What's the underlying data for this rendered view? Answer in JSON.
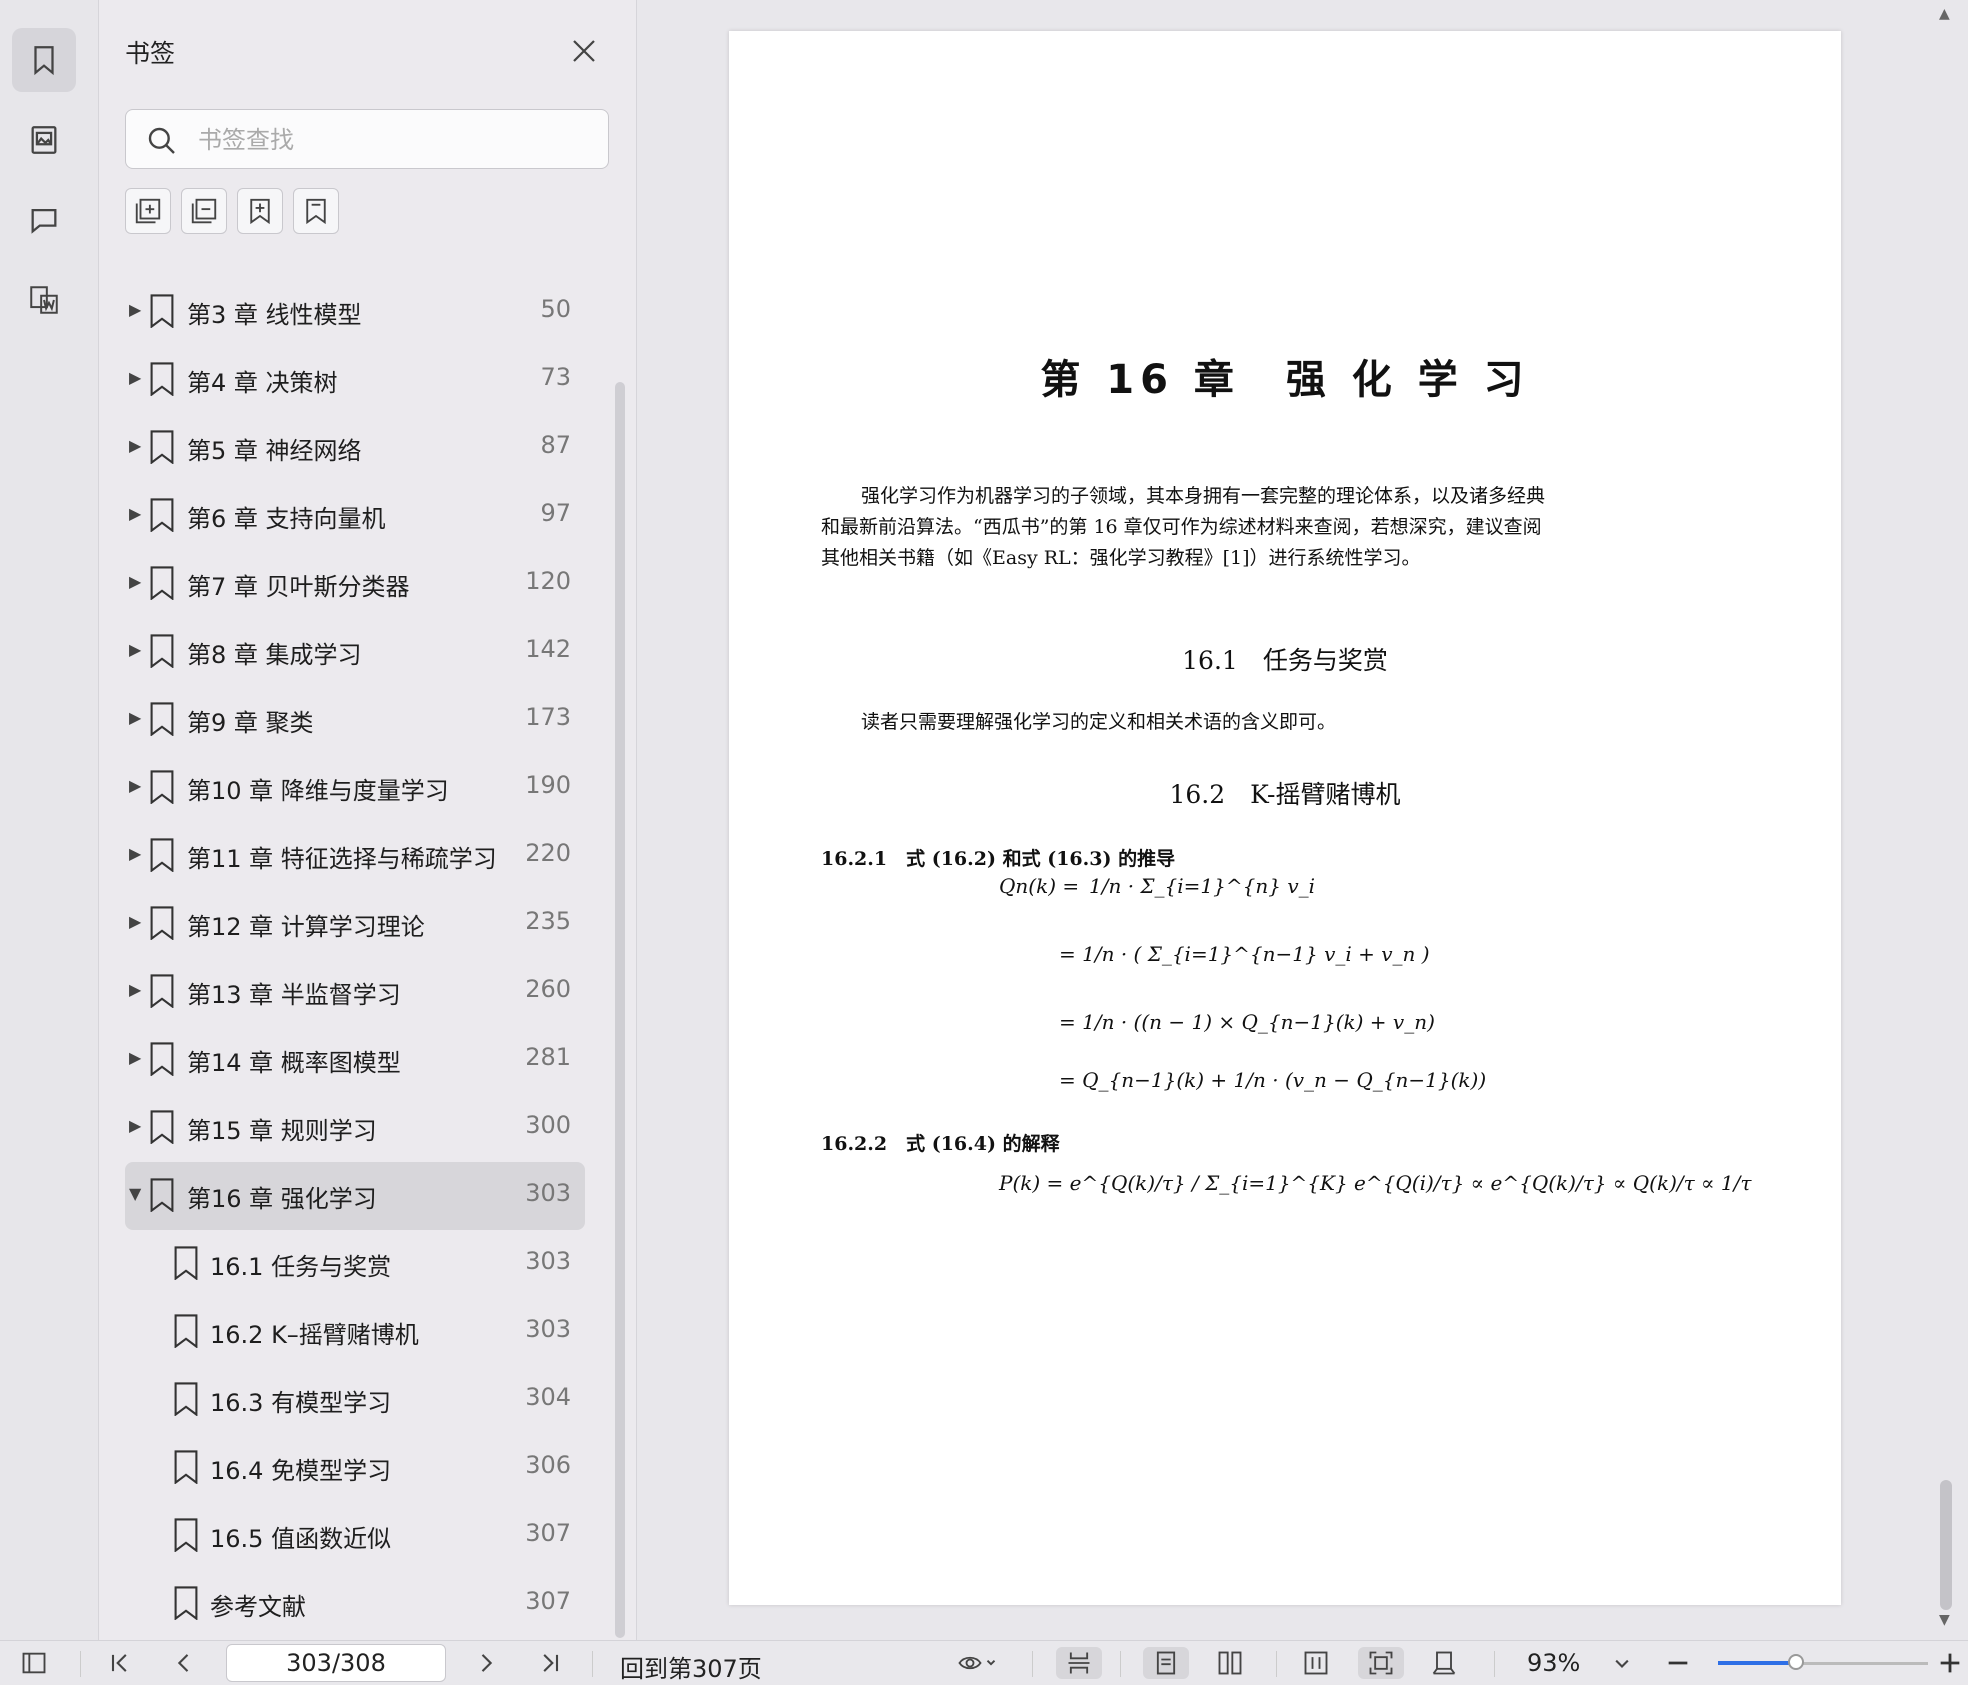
{
  "sidebar": {
    "title": "书签",
    "search_placeholder": "书签查找",
    "items": [
      {
        "label": "第3 章 线性模型",
        "page": "50",
        "expanded": false,
        "level": 0
      },
      {
        "label": "第4 章 决策树",
        "page": "73",
        "expanded": false,
        "level": 0
      },
      {
        "label": "第5 章 神经网络",
        "page": "87",
        "expanded": false,
        "level": 0
      },
      {
        "label": "第6 章 支持向量机",
        "page": "97",
        "expanded": false,
        "level": 0
      },
      {
        "label": "第7 章 贝叶斯分类器",
        "page": "120",
        "expanded": false,
        "level": 0
      },
      {
        "label": "第8 章 集成学习",
        "page": "142",
        "expanded": false,
        "level": 0
      },
      {
        "label": "第9 章 聚类",
        "page": "173",
        "expanded": false,
        "level": 0
      },
      {
        "label": "第10 章 降维与度量学习",
        "page": "190",
        "expanded": false,
        "level": 0
      },
      {
        "label": "第11 章 特征选择与稀疏学习",
        "page": "220",
        "expanded": false,
        "level": 0
      },
      {
        "label": "第12 章 计算学习理论",
        "page": "235",
        "expanded": false,
        "level": 0
      },
      {
        "label": "第13 章 半监督学习",
        "page": "260",
        "expanded": false,
        "level": 0
      },
      {
        "label": "第14 章 概率图模型",
        "page": "281",
        "expanded": false,
        "level": 0
      },
      {
        "label": "第15 章 规则学习",
        "page": "300",
        "expanded": false,
        "level": 0
      },
      {
        "label": "第16 章 强化学习",
        "page": "303",
        "expanded": true,
        "level": 0,
        "selected": true
      },
      {
        "label": "16.1 任务与奖赏",
        "page": "303",
        "level": 1
      },
      {
        "label": "16.2 K–摇臂赌博机",
        "page": "303",
        "level": 1
      },
      {
        "label": "16.3 有模型学习",
        "page": "304",
        "level": 1
      },
      {
        "label": "16.4 免模型学习",
        "page": "306",
        "level": 1
      },
      {
        "label": "16.5 值函数近似",
        "page": "307",
        "level": 1
      },
      {
        "label": "参考文献",
        "page": "307",
        "level": 1
      }
    ]
  },
  "document": {
    "chapter_title": "第 16 章　强 化 学 习",
    "intro": "强化学习作为机器学习的子领域，其本身拥有一套完整的理论体系，以及诸多经典和最新前沿算法。“西瓜书”的第 16 章仅可作为综述材料来查阅，若想深究，建议查阅其他相关书籍（如《Easy RL：强化学习教程》[1]）进行系统性学习。",
    "sec1": "16.1　任务与奖赏",
    "sec1_text": "读者只需要理解强化学习的定义和相关术语的含义即可。",
    "sec2": "16.2　K-摇臂赌博机",
    "sub1": "16.2.1　式 (16.2) 和式 (16.3) 的推导",
    "eq1_lhs": "Qn(k) =",
    "eq1_l1": "1/n · Σ_{i=1}^{n} v_i",
    "eq1_l2": "= 1/n · ( Σ_{i=1}^{n−1} v_i + v_n )",
    "eq1_l3": "= 1/n · ((n − 1) × Q_{n−1}(k) + v_n)",
    "eq1_l4": "= Q_{n−1}(k) + 1/n · (v_n − Q_{n−1}(k))",
    "sub2": "16.2.2　式 (16.4) 的解释",
    "eq2": "P(k) = e^{Q(k)/τ} / Σ_{i=1}^{K} e^{Q(i)/τ} ∝ e^{Q(k)/τ} ∝ Q(k)/τ ∝ 1/τ"
  },
  "status": {
    "page_indicator": "303/308",
    "back_to": "回到第307页",
    "zoom": "93%",
    "zoom_fraction": 0.37
  }
}
